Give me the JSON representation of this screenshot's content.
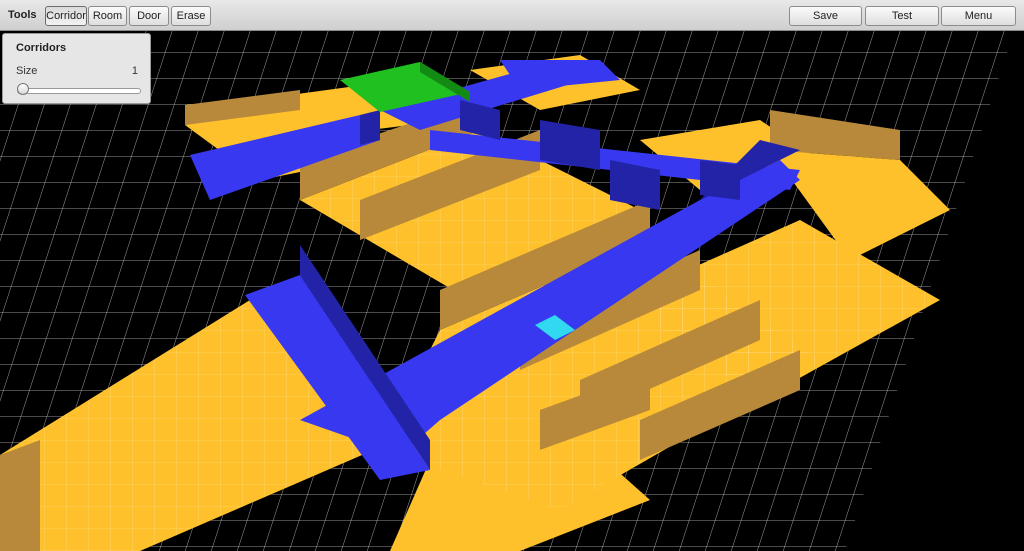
{
  "toolbar": {
    "label": "Tools",
    "tools": [
      "Corridor",
      "Room",
      "Door",
      "Erase"
    ],
    "active_tool": "Corridor",
    "actions": [
      "Save",
      "Test",
      "Menu"
    ]
  },
  "panel": {
    "title": "Corridors",
    "size_label": "Size",
    "size_value": "1"
  },
  "scene": {
    "view": "3D isometric level editor",
    "colors": {
      "background": "#000000",
      "grid": "#ffffff",
      "room_floor": "#ffc12b",
      "room_wall": "#c99c3a",
      "corridor_floor": "#3838f0",
      "corridor_wall": "#2323a8",
      "selected_room": "#20c020",
      "cursor_tile": "#30d8f0"
    }
  }
}
